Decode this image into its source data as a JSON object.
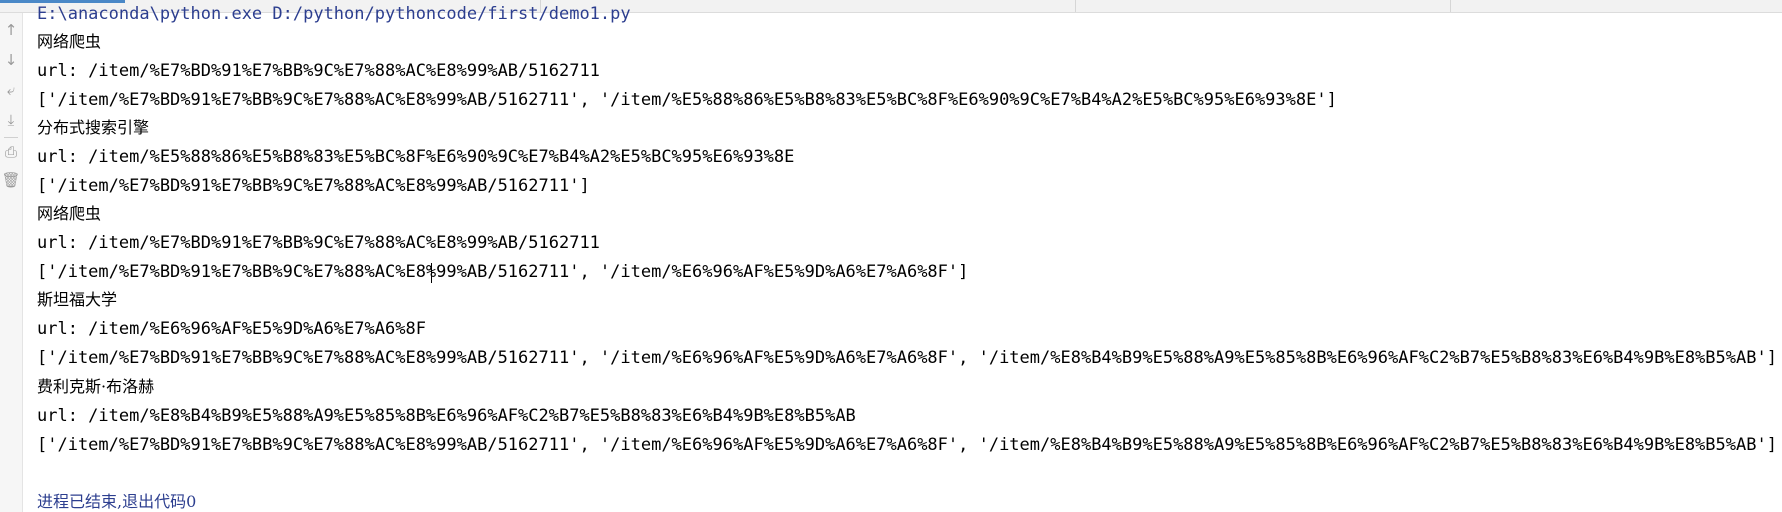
{
  "console": {
    "command_line": "E:\\anaconda\\python.exe D:/python/pythoncode/first/demo1.py",
    "lines": [
      {
        "kind": "cn",
        "text": "网络爬虫"
      },
      {
        "kind": "code",
        "text": "url: /item/%E7%BD%91%E7%BB%9C%E7%88%AC%E8%99%AB/5162711"
      },
      {
        "kind": "code",
        "text": "['/item/%E7%BD%91%E7%BB%9C%E7%88%AC%E8%99%AB/5162711', '/item/%E5%88%86%E5%B8%83%E5%BC%8F%E6%90%9C%E7%B4%A2%E5%BC%95%E6%93%8E']"
      },
      {
        "kind": "cn",
        "text": "分布式搜索引擎"
      },
      {
        "kind": "code",
        "text": "url: /item/%E5%88%86%E5%B8%83%E5%BC%8F%E6%90%9C%E7%B4%A2%E5%BC%95%E6%93%8E"
      },
      {
        "kind": "code",
        "text": "['/item/%E7%BD%91%E7%BB%9C%E7%88%AC%E8%99%AB/5162711']"
      },
      {
        "kind": "cn",
        "text": "网络爬虫"
      },
      {
        "kind": "code",
        "text": "url: /item/%E7%BD%91%E7%BB%9C%E7%88%AC%E8%99%AB/5162711"
      },
      {
        "kind": "code",
        "text": "['/item/%E7%BD%91%E7%BB%9C%E7%88%AC%E8%99%AB/5162711', '/item/%E6%96%AF%E5%9D%A6%E7%A6%8F']"
      },
      {
        "kind": "cn",
        "text": "斯坦福大学"
      },
      {
        "kind": "code",
        "text": "url: /item/%E6%96%AF%E5%9D%A6%E7%A6%8F"
      },
      {
        "kind": "code",
        "text": "['/item/%E7%BD%91%E7%BB%9C%E7%88%AC%E8%99%AB/5162711', '/item/%E6%96%AF%E5%9D%A6%E7%A6%8F', '/item/%E8%B4%B9%E5%88%A9%E5%85%8B%E6%96%AF%C2%B7%E5%B8%83%E6%B4%9B%E8%B5%AB']"
      },
      {
        "kind": "cn",
        "text": "费利克斯·布洛赫"
      },
      {
        "kind": "code",
        "text": "url: /item/%E8%B4%B9%E5%88%A9%E5%85%8B%E6%96%AF%C2%B7%E5%B8%83%E6%B4%9B%E8%B5%AB"
      },
      {
        "kind": "code",
        "text": "['/item/%E7%BD%91%E7%BB%9C%E7%88%AC%E8%99%AB/5162711', '/item/%E6%96%AF%E5%9D%A6%E7%A6%8F', '/item/%E8%B4%B9%E5%88%A9%E5%85%8B%E6%96%AF%C2%B7%E5%B8%83%E6%B4%9B%E8%B5%AB']"
      }
    ],
    "exit_message": "进程已结束,退出代码0"
  },
  "toolbar": {
    "icons": [
      "arrow-up-icon",
      "arrow-down-icon",
      "soft-wrap-icon",
      "scroll-to-end-icon",
      "print-icon",
      "trash-icon"
    ],
    "glyphs": [
      "↑",
      "↓",
      "⤶",
      "⤓",
      "⎙",
      "🗑"
    ]
  }
}
